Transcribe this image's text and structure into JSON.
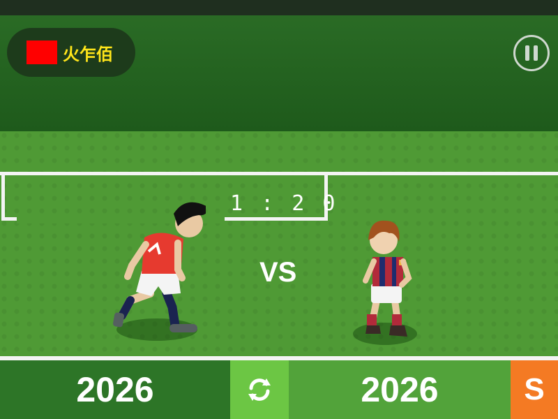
{
  "hud": {
    "team_name": "火乍佰",
    "flag_color": "#ff0000",
    "team_name_color": "#ffe51a"
  },
  "match": {
    "score": "1 : 2 0",
    "vs_label": "VS"
  },
  "bottom_bar": {
    "left_year": "2026",
    "right_year": "2026",
    "s_label": "S",
    "accent_orange": "#f47a23",
    "swap_color": "#6cc644"
  },
  "icons": {
    "pause": "pause-icon",
    "swap": "swap-arrows-icon"
  },
  "players": [
    {
      "kit": "red-white",
      "role": "left-player"
    },
    {
      "kit": "crimson-navy-stripes",
      "role": "right-player"
    }
  ]
}
